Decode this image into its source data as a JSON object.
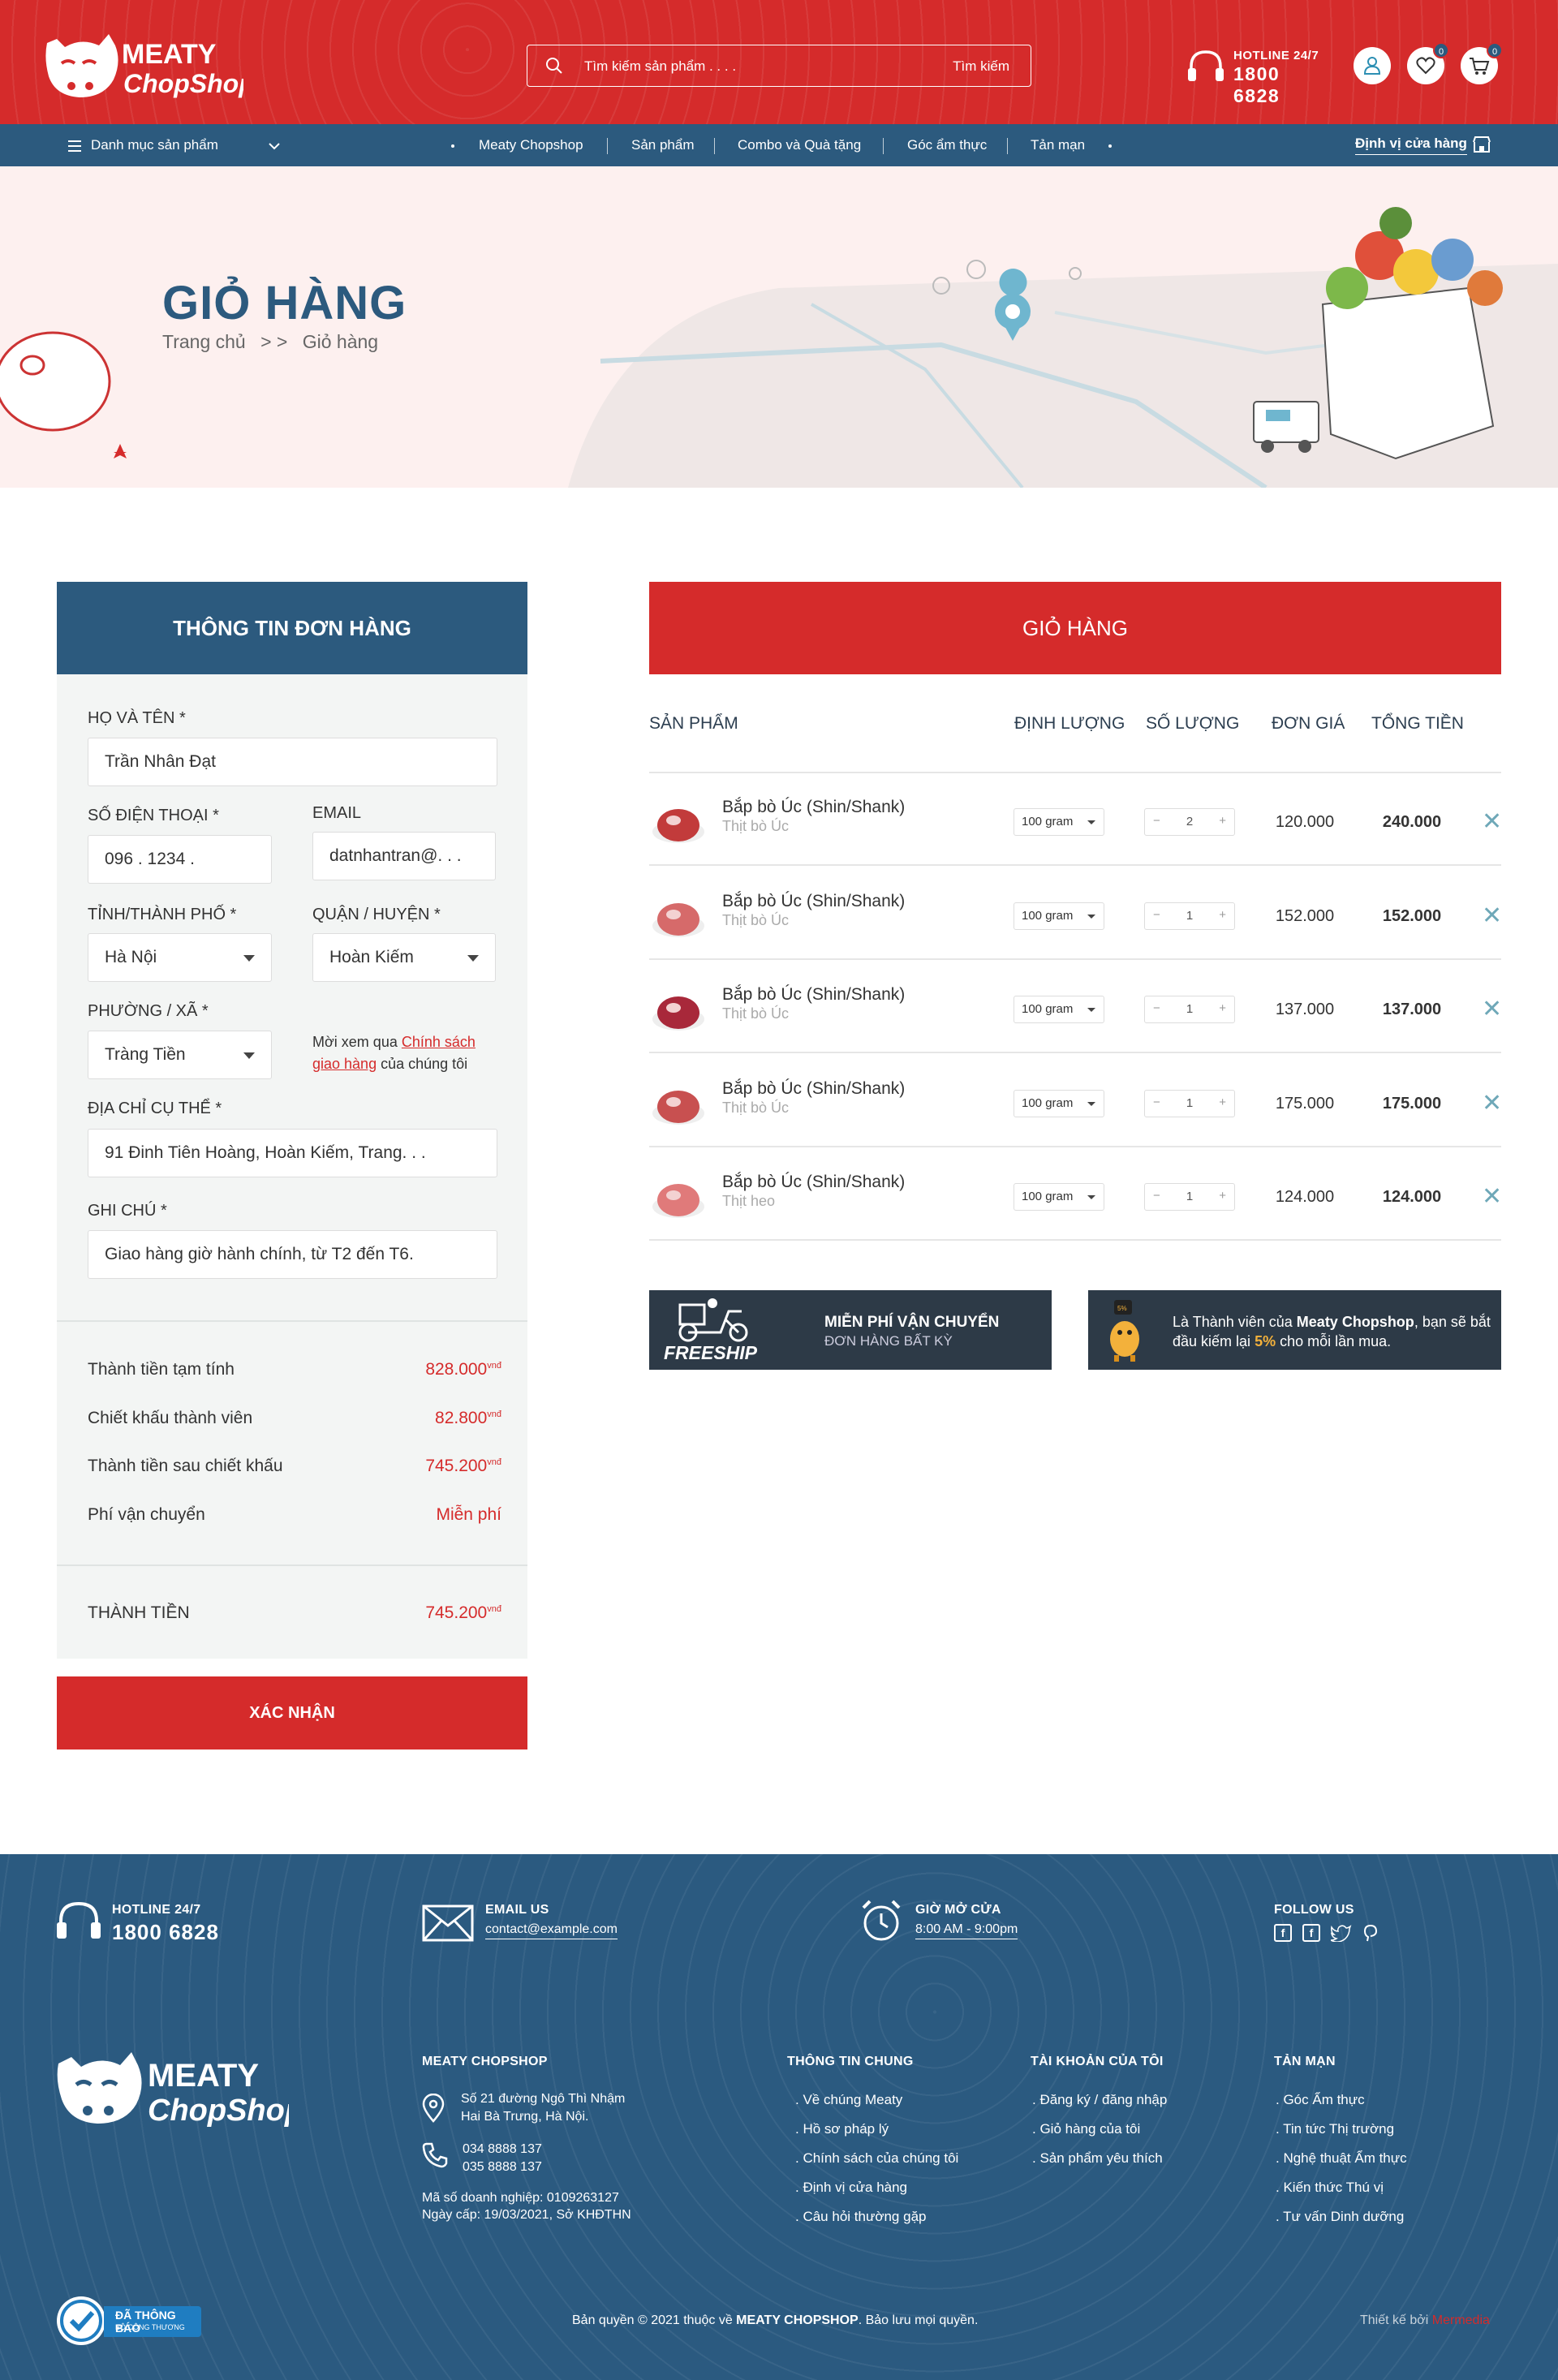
{
  "header": {
    "search_placeholder": "Tìm kiếm sản phẩm . . . .",
    "search_button": "Tìm kiếm",
    "hotline_label": "HOTLINE 24/7",
    "hotline_number": "1800 6828",
    "wishlist_count": "0",
    "cart_count": "0"
  },
  "nav": {
    "categories": "Danh mục sản phẩm",
    "items": [
      "Meaty Chopshop",
      "Sản phẩm",
      "Combo và Quà tặng",
      "Góc ẩm thực",
      "Tản mạn"
    ],
    "store_locator": "Định vị cửa hàng"
  },
  "banner": {
    "title": "GIỎ HÀNG",
    "breadcrumb_home": "Trang chủ",
    "breadcrumb_sep": "> >",
    "breadcrumb_current": "Giỏ hàng"
  },
  "order_form": {
    "heading": "THÔNG TIN ĐƠN HÀNG",
    "name_label": "HỌ VÀ TÊN *",
    "name_value": "Trần Nhân Đạt",
    "phone_label": "SỐ ĐIỆN THOẠI *",
    "phone_value": "096 . 1234 .",
    "email_label": "EMAIL",
    "email_value": "datnhantran@. . .",
    "province_label": "TỈNH/THÀNH PHỐ *",
    "province_value": "Hà Nội",
    "district_label": "QUẬN / HUYỆN *",
    "district_value": "Hoàn Kiếm",
    "ward_label": "PHƯỜNG / XÃ *",
    "ward_value": "Tràng Tiền",
    "policy_pre": "Mời xem qua",
    "policy_link": "Chính sách giao hàng",
    "policy_post": "của chúng tôi",
    "address_label": "ĐỊA CHỈ CỤ THỂ *",
    "address_value": "91 Đinh Tiên Hoàng, Hoàn Kiếm, Trang. . .",
    "note_label": "GHI CHÚ *",
    "note_value": "Giao hàng giờ hành chính, từ T2 đến T6."
  },
  "summary": {
    "subtotal_label": "Thành tiền tạm tính",
    "subtotal_value": "828.000",
    "discount_label": "Chiết khấu thành viên",
    "discount_value": "82.800",
    "after_discount_label": "Thành tiền sau chiết khấu",
    "after_discount_value": "745.200",
    "shipping_label": "Phí vận chuyển",
    "shipping_value": "Miễn phí",
    "total_label": "THÀNH TIỀN",
    "total_value": "745.200",
    "currency": "vnđ",
    "confirm_button": "XÁC NHẬN"
  },
  "cart": {
    "heading": "GIỎ HÀNG",
    "columns": [
      "SẢN PHẨM",
      "ĐỊNH LƯỢNG",
      "SỐ LƯỢNG",
      "ĐƠN GIÁ",
      "TỔNG TIỀN"
    ],
    "items": [
      {
        "name": "Bắp bò Úc (Shin/Shank)",
        "sub": "Thịt bò Úc",
        "weight": "100 gram",
        "qty": "2",
        "price": "120.000",
        "total": "240.000"
      },
      {
        "name": "Bắp bò Úc (Shin/Shank)",
        "sub": "Thịt bò Úc",
        "weight": "100 gram",
        "qty": "1",
        "price": "152.000",
        "total": "152.000"
      },
      {
        "name": "Bắp bò Úc (Shin/Shank)",
        "sub": "Thịt bò Úc",
        "weight": "100 gram",
        "qty": "1",
        "price": "137.000",
        "total": "137.000"
      },
      {
        "name": "Bắp bò Úc (Shin/Shank)",
        "sub": "Thịt bò Úc",
        "weight": "100 gram",
        "qty": "1",
        "price": "175.000",
        "total": "175.000"
      },
      {
        "name": "Bắp bò Úc (Shin/Shank)",
        "sub": "Thịt heo",
        "weight": "100 gram",
        "qty": "1",
        "price": "124.000",
        "total": "124.000"
      }
    ],
    "promo_freeship": "FREESHIP",
    "promo_ship_title": "MIỄN PHÍ VẬN CHUYỂN",
    "promo_ship_sub": "ĐƠN HÀNG BẤT KỲ",
    "promo_member_pre": "Là Thành viên của",
    "promo_member_brand": "Meaty Chopshop",
    "promo_member_mid": ", bạn sẽ bắt đầu kiếm lại",
    "promo_member_pct": "5%",
    "promo_member_post": "cho mỗi lần mua."
  },
  "footer": {
    "hotline_label": "HOTLINE 24/7",
    "hotline_number": "1800 6828",
    "email_label": "EMAIL US",
    "email_value": "contact@example.com",
    "hours_label": "GIỜ MỞ CỬA",
    "hours_value": "8:00 AM  -  9:00pm",
    "follow_label": "FOLLOW US",
    "company_title": "MEATY CHOPSHOP",
    "address_line1": "Số 21 đường Ngô Thì Nhậm",
    "address_line2": "Hai Bà Trưng, Hà Nội.",
    "phone1": "034 8888 137",
    "phone2": "035 8888 137",
    "tax_id": "Mã số doanh nghiệp: 0109263127",
    "issued": "Ngày cấp: 19/03/2021, Sở KHĐTHN",
    "col_general": "THÔNG TIN CHUNG",
    "general_links": [
      "Về chúng Meaty",
      "Hồ sơ pháp lý",
      "Chính sách của chúng tôi",
      "Định vị cửa hàng",
      "Câu hỏi thường gặp"
    ],
    "col_account": "TÀI KHOẢN CỦA TÔI",
    "account_links": [
      "Đăng ký / đăng nhập",
      "Giỏ hàng của tôi",
      "Sản phẩm yêu thích"
    ],
    "col_misc": "TẢN MẠN",
    "misc_links": [
      "Góc Ẩm thực",
      "Tin tức Thị trường",
      "Nghệ thuật Ẩm thực",
      "Kiến thức Thú vị",
      "Tư vấn Dinh dưỡng"
    ],
    "badge_title": "ĐÃ THÔNG BÁO",
    "badge_sub": "BỘ CÔNG THƯƠNG",
    "copyright_pre": "Bản quyền © 2021 thuộc về",
    "copyright_brand": "MEATY CHOPSHOP",
    "copyright_post": ". Bảo lưu mọi quyền.",
    "designed_by": "Thiết kế bởi",
    "designer": "Mermedia"
  },
  "colors": {
    "brand_red": "#d52b2b",
    "brand_blue": "#2c5a7e",
    "footer_blue": "#2b5a80"
  }
}
